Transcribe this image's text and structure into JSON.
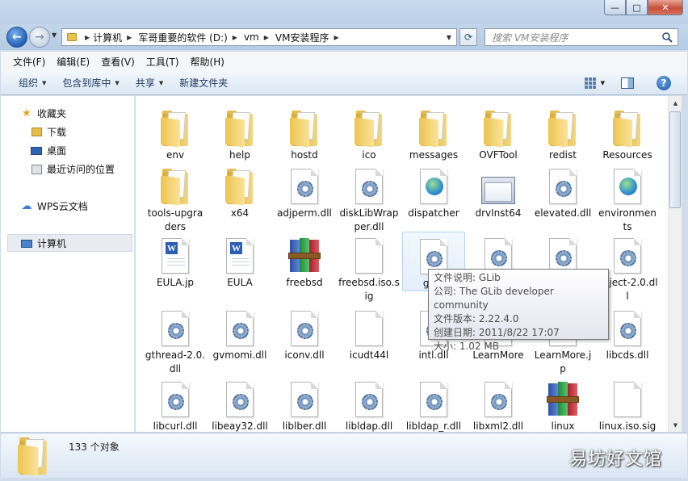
{
  "window": {
    "minimize_label": "—",
    "maximize_label": "□",
    "close_label": "✕"
  },
  "address": {
    "crumbs": [
      "计算机",
      "军哥重要的软件 (D:)",
      "vm",
      "VM安装程序"
    ]
  },
  "search": {
    "placeholder": "搜索 VM安装程序"
  },
  "menu": [
    "文件(F)",
    "编辑(E)",
    "查看(V)",
    "工具(T)",
    "帮助(H)"
  ],
  "commands": {
    "organize": "组织",
    "include_library": "包含到库中",
    "share": "共享",
    "new_folder": "新建文件夹"
  },
  "nav": {
    "favorites": "收藏夹",
    "downloads": "下载",
    "desktop": "桌面",
    "recent": "最近访问的位置",
    "wps": "WPS云文档",
    "computer": "计算机"
  },
  "files": [
    {
      "name": "env",
      "type": "folder"
    },
    {
      "name": "help",
      "type": "folder"
    },
    {
      "name": "hostd",
      "type": "folder"
    },
    {
      "name": "ico",
      "type": "folder"
    },
    {
      "name": "messages",
      "type": "folder"
    },
    {
      "name": "OVFTool",
      "type": "folder"
    },
    {
      "name": "redist",
      "type": "folder"
    },
    {
      "name": "Resources",
      "type": "folder"
    },
    {
      "name": "tools-upgraders",
      "type": "folder"
    },
    {
      "name": "x64",
      "type": "folder"
    },
    {
      "name": "adjperm.dll",
      "type": "dll"
    },
    {
      "name": "diskLibWrapper.dll",
      "type": "dll"
    },
    {
      "name": "dispatcher",
      "type": "web"
    },
    {
      "name": "drvInst64",
      "type": "exe"
    },
    {
      "name": "elevated.dll",
      "type": "dll"
    },
    {
      "name": "environments",
      "type": "web"
    },
    {
      "name": "EULA.jp",
      "type": "word"
    },
    {
      "name": "EULA",
      "type": "word"
    },
    {
      "name": "freebsd",
      "type": "winrar"
    },
    {
      "name": "freebsd.iso.sig",
      "type": "doc"
    },
    {
      "name": "glib-",
      "type": "dll"
    },
    {
      "name": "",
      "type": "dll"
    },
    {
      "name": "",
      "type": "dll"
    },
    {
      "name": "object-2.0.dll",
      "type": "dll"
    },
    {
      "name": "gthread-2.0.dll",
      "type": "dll"
    },
    {
      "name": "gvmomi.dll",
      "type": "dll"
    },
    {
      "name": "iconv.dll",
      "type": "dll"
    },
    {
      "name": "icudt44l",
      "type": "doc"
    },
    {
      "name": "intl.dll",
      "type": "dll"
    },
    {
      "name": "LearnMore",
      "type": "web"
    },
    {
      "name": "LearnMore.jp",
      "type": "web"
    },
    {
      "name": "libcds.dll",
      "type": "dll"
    },
    {
      "name": "libcurl.dll",
      "type": "dll"
    },
    {
      "name": "libeay32.dll",
      "type": "dll"
    },
    {
      "name": "liblber.dll",
      "type": "dll"
    },
    {
      "name": "libldap.dll",
      "type": "dll"
    },
    {
      "name": "libldap_r.dll",
      "type": "dll"
    },
    {
      "name": "libxml2.dll",
      "type": "dll"
    },
    {
      "name": "linux",
      "type": "winrar"
    },
    {
      "name": "linux.iso.sig",
      "type": "doc"
    }
  ],
  "tooltip": {
    "line1": "文件说明: GLib",
    "line2": "公司: The GLib developer community",
    "line3": "文件版本: 2.22.4.0",
    "line4": "创建日期: 2011/8/22 17:07",
    "line5": "大小: 1.02 MB"
  },
  "status": {
    "count_text": "133 个对象"
  },
  "watermark": "易坊好文馆"
}
